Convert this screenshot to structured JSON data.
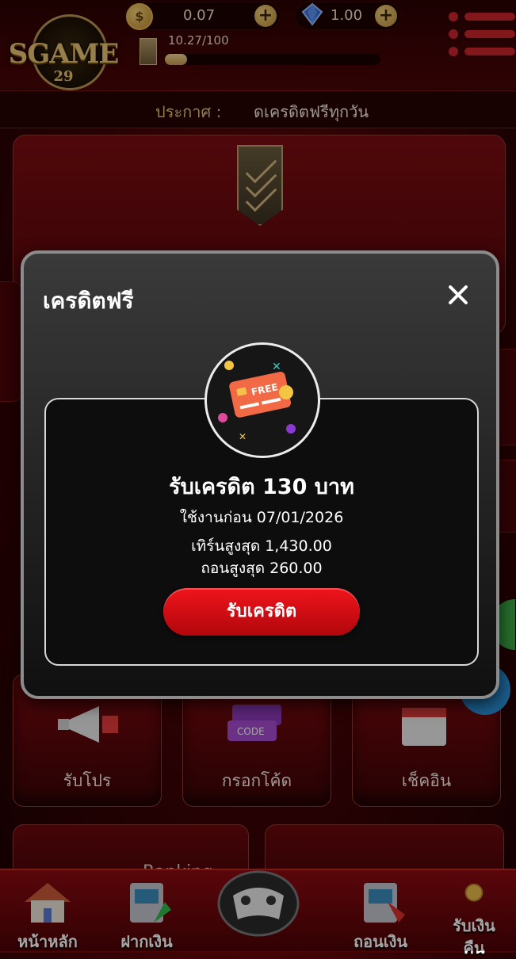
{
  "header": {
    "logo_text": "SGAME",
    "logo_number": "29",
    "coin_balance": "0.07",
    "gem_balance": "1.00",
    "xp_text": "10.27/100",
    "xp_progress": 0.1027
  },
  "announcement": {
    "label": "ประกาศ :",
    "text": "ดเครดิตฟรีทุกวัน"
  },
  "tiles": [
    {
      "label": "รับโปร"
    },
    {
      "label": "กรอกโค้ด"
    },
    {
      "label": "เช็คอิน"
    }
  ],
  "lower": {
    "ranking": "Ranking"
  },
  "bottom_nav": [
    {
      "label": "หน้าหลัก"
    },
    {
      "label": "ฝากเงิน"
    },
    {
      "label": "ถอนเงิน"
    },
    {
      "label": "รับเงิน\nคืน"
    }
  ],
  "modal": {
    "title": "เครดิตฟรี",
    "badge_text": "FREE",
    "reward_title": "รับเครดิต 130 บาท",
    "expire": "ใช้งานก่อน 07/01/2026",
    "max_turnover": "เทิร์นสูงสุด 1,430.00",
    "max_withdraw": "ถอนสูงสุด 260.00",
    "claim_label": "รับเครดิต"
  },
  "colors": {
    "accent_red": "#c8252a",
    "gold": "#e2bf79",
    "claim_button": "#e8121a"
  }
}
